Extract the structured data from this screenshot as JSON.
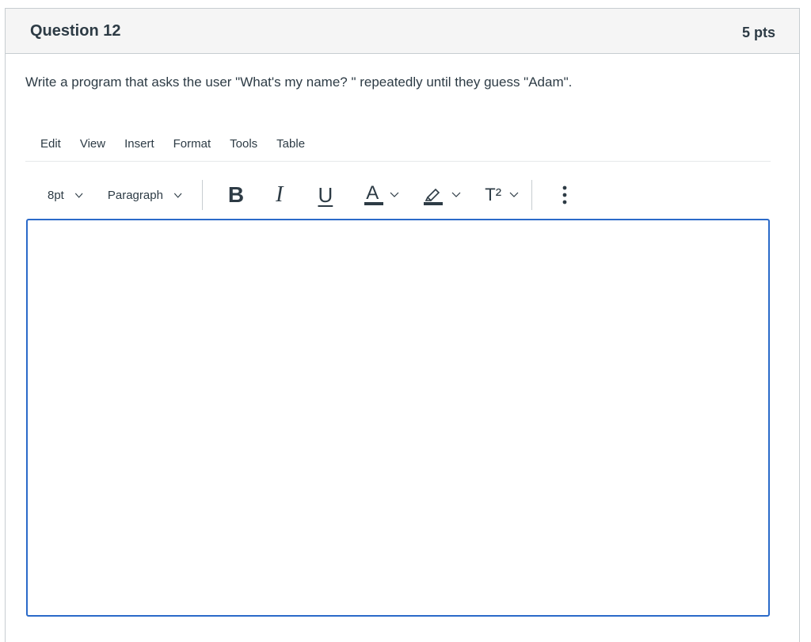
{
  "question": {
    "title": "Question 12",
    "points": "5 pts",
    "text": "Write a program that asks the user \"What's my name? \" repeatedly until they guess \"Adam\"."
  },
  "menubar": {
    "items": [
      {
        "label": "Edit"
      },
      {
        "label": "View"
      },
      {
        "label": "Insert"
      },
      {
        "label": "Format"
      },
      {
        "label": "Tools"
      },
      {
        "label": "Table"
      }
    ]
  },
  "toolbar": {
    "font_size": "8pt",
    "block_format": "Paragraph",
    "bold_label": "B",
    "italic_label": "I",
    "underline_label": "U",
    "text_color_label": "A",
    "superscript_label": "T²",
    "icons": {
      "font_size_chevron": "chevron-down-icon",
      "block_format_chevron": "chevron-down-icon",
      "highlight": "highlighter-icon",
      "more": "more-vertical-icon"
    }
  },
  "editor": {
    "content": ""
  },
  "colors": {
    "accent_border": "#2b6ac9",
    "header_bg": "#f5f5f5",
    "text": "#2d3b45",
    "divider": "#c7cdd1"
  }
}
